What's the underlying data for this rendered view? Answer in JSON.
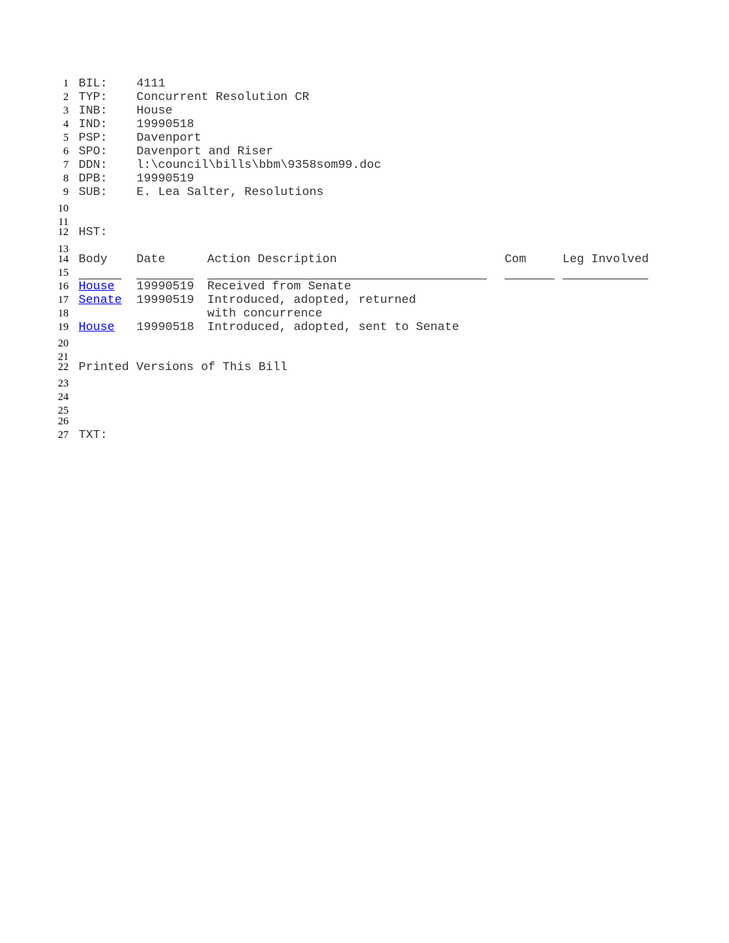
{
  "fields": [
    {
      "num": "1",
      "label": "BIL:",
      "value": "4111"
    },
    {
      "num": "2",
      "label": "TYP:",
      "value": "Concurrent Resolution CR"
    },
    {
      "num": "3",
      "label": "INB:",
      "value": "House"
    },
    {
      "num": "4",
      "label": "IND:",
      "value": "19990518"
    },
    {
      "num": "5",
      "label": "PSP:",
      "value": "Davenport"
    },
    {
      "num": "6",
      "label": "SPO:",
      "value": "Davenport and Riser"
    },
    {
      "num": "7",
      "label": "DDN:",
      "value": "l:\\council\\bills\\bbm\\9358som99.doc"
    },
    {
      "num": "8",
      "label": "DPB:",
      "value": "19990519"
    },
    {
      "num": "9",
      "label": "SUB:",
      "value": "E. Lea Salter, Resolutions"
    }
  ],
  "blank_lines": [
    "10",
    "11",
    "13",
    "15",
    "18",
    "20",
    "21",
    "23",
    "24",
    "25",
    "26"
  ],
  "history": {
    "num": "12",
    "label": "HST:",
    "header_num": "14",
    "headers": {
      "body": "Body",
      "date": "Date",
      "action": "Action Description",
      "com": "Com",
      "leg": "Leg Involved"
    },
    "rule_num": "15",
    "rows": [
      {
        "num": "16",
        "body": "House",
        "date": "19990519",
        "action": "Received from Senate"
      },
      {
        "num": "17",
        "body": "Senate",
        "date": "19990519",
        "action": "Introduced, adopted, returned"
      },
      {
        "num": "18",
        "body": "",
        "date": "",
        "action": "with concurrence"
      },
      {
        "num": "19",
        "body": "House",
        "date": "19990518",
        "action": "Introduced, adopted, sent to Senate"
      }
    ]
  },
  "printed_versions": {
    "num": "22",
    "label": "Printed Versions of This Bill"
  },
  "text_section": {
    "num": "27",
    "label": "TXT:"
  },
  "colors": {
    "link": "#0000ee",
    "text": "#333333"
  }
}
